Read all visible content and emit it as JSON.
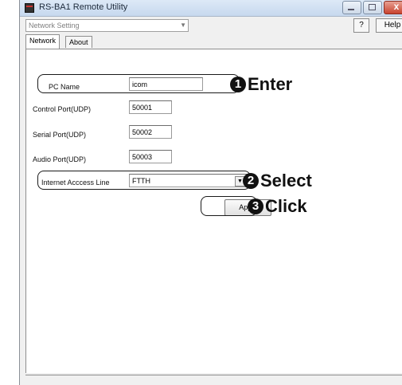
{
  "window": {
    "title": "RS-BA1 Remote Utility"
  },
  "top": {
    "dropdown_value": "Network Setting",
    "help_q": "?",
    "help_label": "Help"
  },
  "tabs": [
    {
      "label": "Network"
    },
    {
      "label": "About"
    }
  ],
  "form": {
    "pc_name": {
      "label": "PC Name",
      "value": "icom"
    },
    "control_port": {
      "label": "Control Port(UDP)",
      "value": "50001"
    },
    "serial_port": {
      "label": "Serial Port(UDP)",
      "value": "50002"
    },
    "audio_port": {
      "label": "Audio Port(UDP)",
      "value": "50003"
    },
    "internet_line": {
      "label": "Internet Acccess Line",
      "value": "FTTH"
    },
    "apply_label": "Apply"
  },
  "callouts": [
    {
      "num": "1",
      "text": "Enter"
    },
    {
      "num": "2",
      "text": "Select"
    },
    {
      "num": "3",
      "text": "Click"
    }
  ],
  "icons": {
    "app": "app-icon",
    "dropdown": "chevron-down-icon"
  }
}
